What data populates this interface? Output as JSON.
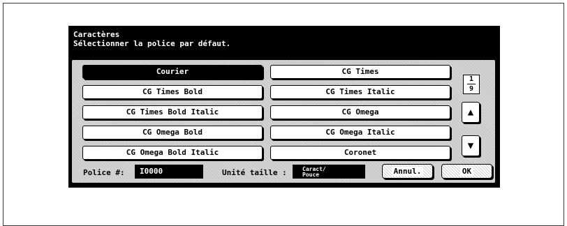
{
  "header": {
    "title": "Caractères",
    "subtitle": "Sélectionner la police par défaut."
  },
  "fonts": [
    {
      "label": "Courier",
      "selected": true
    },
    {
      "label": "CG Times",
      "selected": false
    },
    {
      "label": "CG Times Bold",
      "selected": false
    },
    {
      "label": "CG Times Italic",
      "selected": false
    },
    {
      "label": "CG Times Bold Italic",
      "selected": false
    },
    {
      "label": "CG Omega",
      "selected": false
    },
    {
      "label": "CG Omega Bold",
      "selected": false
    },
    {
      "label": "CG Omega Italic",
      "selected": false
    },
    {
      "label": "CG Omega Bold Italic",
      "selected": false
    },
    {
      "label": "Coronet",
      "selected": false
    }
  ],
  "pager": {
    "current": "1",
    "total": "9"
  },
  "icons": {
    "up": "arrow-up-icon",
    "down": "arrow-down-icon"
  },
  "footer": {
    "police_label": "Police #:",
    "police_value": "I0000",
    "unit_label": "Unité taille :",
    "unit_value_line1": "Caract/",
    "unit_value_line2": "Pouce",
    "cancel_label": "Annul.",
    "ok_label": "OK"
  }
}
